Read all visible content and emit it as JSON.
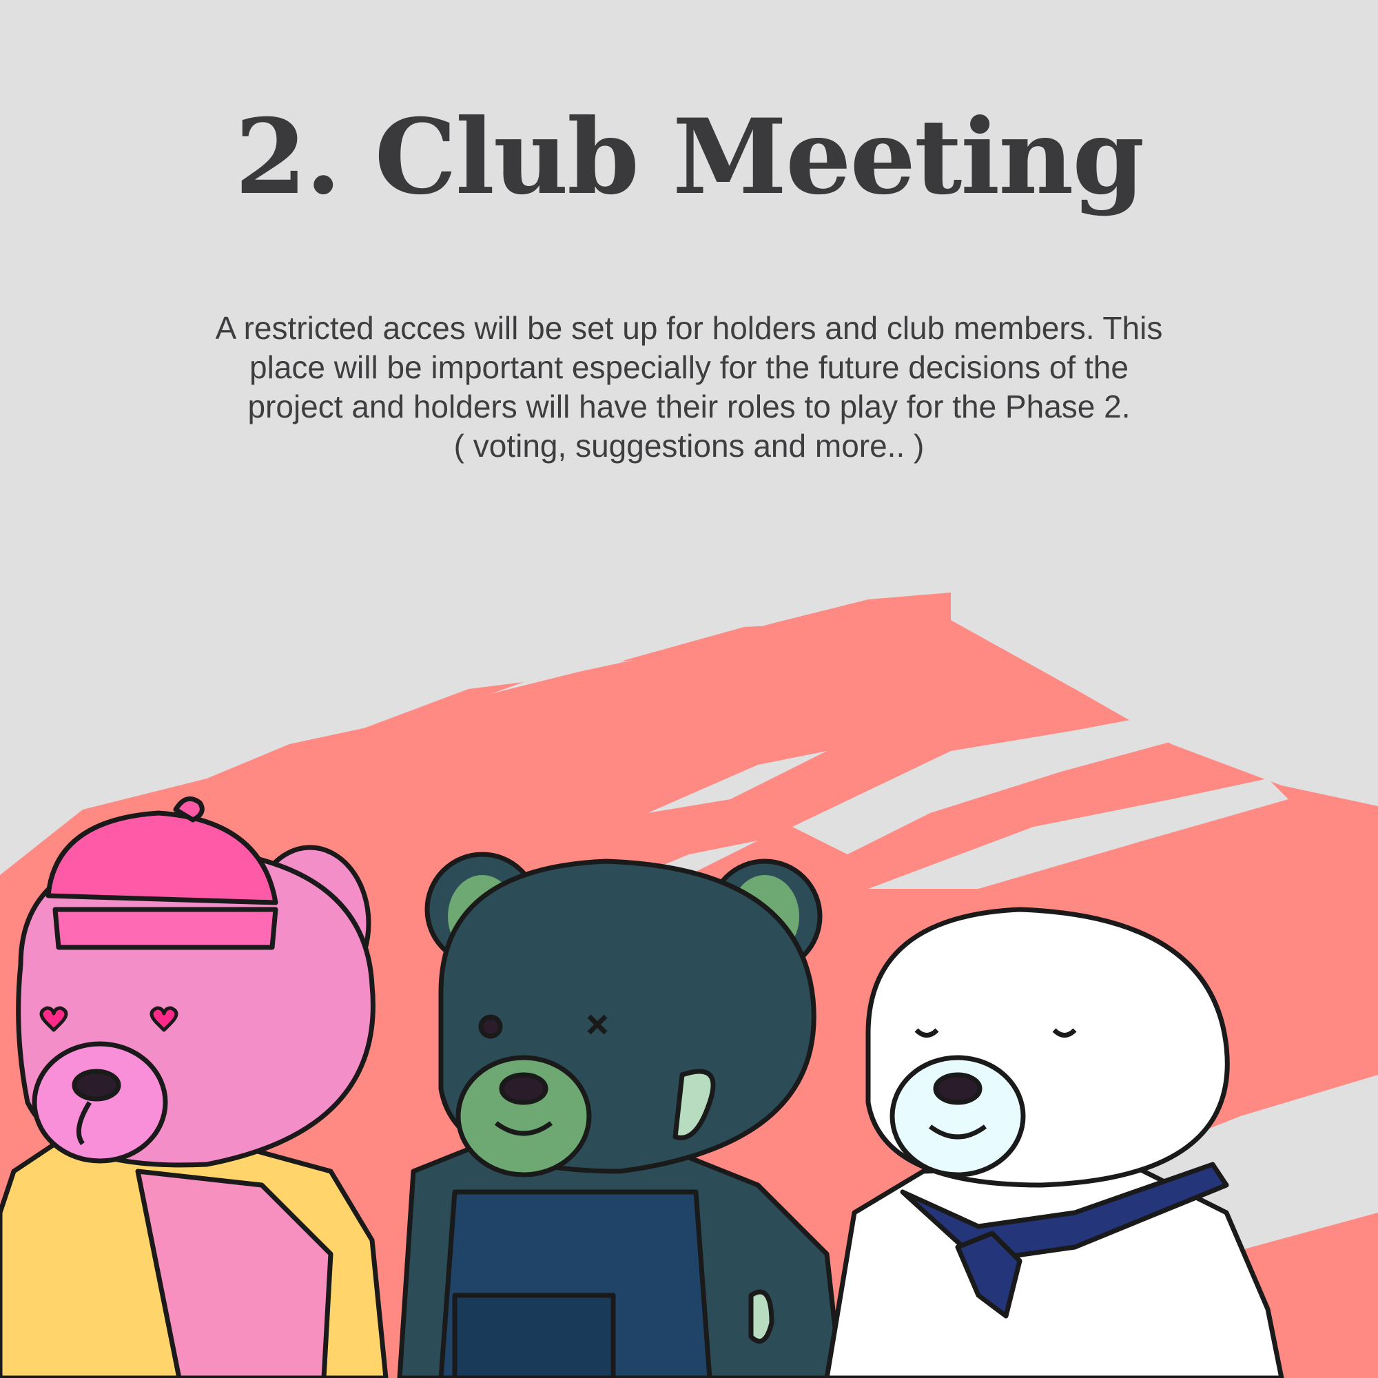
{
  "title": "2. Club Meeting",
  "description": {
    "lines": [
      "A restricted acces will be set up for holders and club members. This",
      "place will be important especially for the future decisions of the",
      "project and holders will have their roles to play for the Phase 2.",
      "( voting, suggestions and more.. )"
    ]
  },
  "colors": {
    "background": "#e0e0e0",
    "brush": "#ff8a84",
    "text": "#3a3a3c"
  },
  "characters": [
    {
      "name": "pink-bear-beanie",
      "fur": "#f48ec8",
      "shirt": "#ffd46a"
    },
    {
      "name": "zombie-bear-overalls",
      "fur": "#2c4d57",
      "overalls": "#1f4468"
    },
    {
      "name": "white-bear-sailor",
      "fur": "#ffffff",
      "scarf": "#24357a"
    }
  ]
}
